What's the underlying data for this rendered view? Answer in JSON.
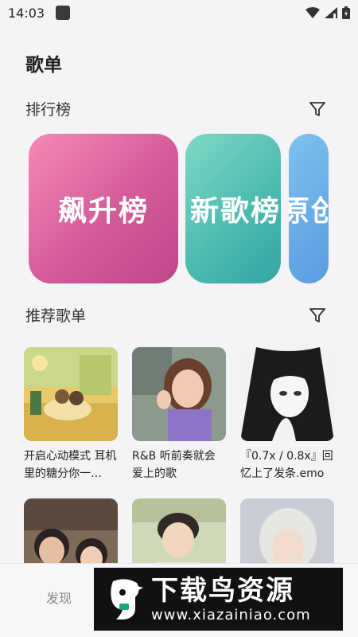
{
  "status_bar": {
    "time": "14:03",
    "icons": [
      "notification-icon",
      "wifi-icon",
      "signal-icon",
      "battery-icon"
    ]
  },
  "page": {
    "title": "歌单"
  },
  "charts_section": {
    "title": "排行榜",
    "filter_icon": "filter-icon",
    "cards": [
      {
        "label": "飙升榜",
        "color": "#d45a98"
      },
      {
        "label": "新歌榜",
        "color": "#4bb9ae"
      },
      {
        "label": "原创",
        "color": "#5a9be0"
      }
    ]
  },
  "recommend_section": {
    "title": "推荐歌单",
    "filter_icon": "filter-icon",
    "playlists": [
      {
        "title": "开启心动模式 耳机里的糖分你一…"
      },
      {
        "title": "R&B 听前奏就会爱上的歌"
      },
      {
        "title": "『0.7x / 0.8x』回忆上了发条.emo"
      },
      {
        "title": ""
      },
      {
        "title": ""
      },
      {
        "title": ""
      }
    ]
  },
  "bottom_nav": {
    "discover": "发现"
  },
  "watermark": {
    "name": "下载鸟资源",
    "url": "www.xiazainiao.com"
  }
}
